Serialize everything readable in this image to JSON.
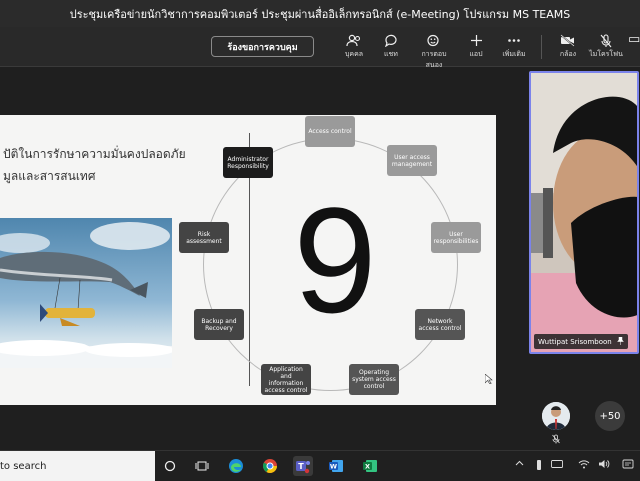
{
  "window": {
    "title": "ประชุมเครือข่ายนักวิชาการคอมพิวเตอร์ ประชุมผ่านสื่ออิเล็กทรอนิกส์ (e-Meeting) โปรแกรม MS TEAMS"
  },
  "toolbar": {
    "request_control_label": "ร้องขอการควบคุม",
    "items": [
      {
        "label": "บุคคล",
        "icon": "people-icon"
      },
      {
        "label": "แชท",
        "icon": "chat-icon"
      },
      {
        "label": "การตอบสนอง",
        "icon": "reactions-icon"
      },
      {
        "label": "แอป",
        "icon": "plus-icon"
      },
      {
        "label": "เพิ่มเติม",
        "icon": "more-icon"
      },
      {
        "label": "กล้อง",
        "icon": "camera-off-icon"
      },
      {
        "label": "ไมโครโฟน",
        "icon": "mic-off-icon"
      }
    ]
  },
  "slide": {
    "title_line1": "ปัติในการรักษาความมั่นคงปลอดภัย",
    "title_line2": "มูลและสารสนเทศ",
    "big_number": "9",
    "nodes": [
      {
        "label": "Access control"
      },
      {
        "label": "User access management"
      },
      {
        "label": "User responsibilities"
      },
      {
        "label": "Network access control"
      },
      {
        "label": "Operating system access control"
      },
      {
        "label": "Application and information access control"
      },
      {
        "label": "Backup and Recovery"
      },
      {
        "label": "Risk assessment"
      },
      {
        "label": "Administrator Responsibility"
      }
    ]
  },
  "video": {
    "participant_name": "Wuttipat Srisomboon"
  },
  "participants": {
    "more_count": "+50"
  },
  "taskbar": {
    "search_text": "to search",
    "apps": [
      "task-view-icon",
      "edge-icon",
      "chrome-icon",
      "teams-icon",
      "word-icon",
      "excel-icon"
    ]
  },
  "colors": {
    "accent": "#7b83eb",
    "toolbar_bg": "#292929",
    "slide_bg": "#f5f5f4"
  }
}
